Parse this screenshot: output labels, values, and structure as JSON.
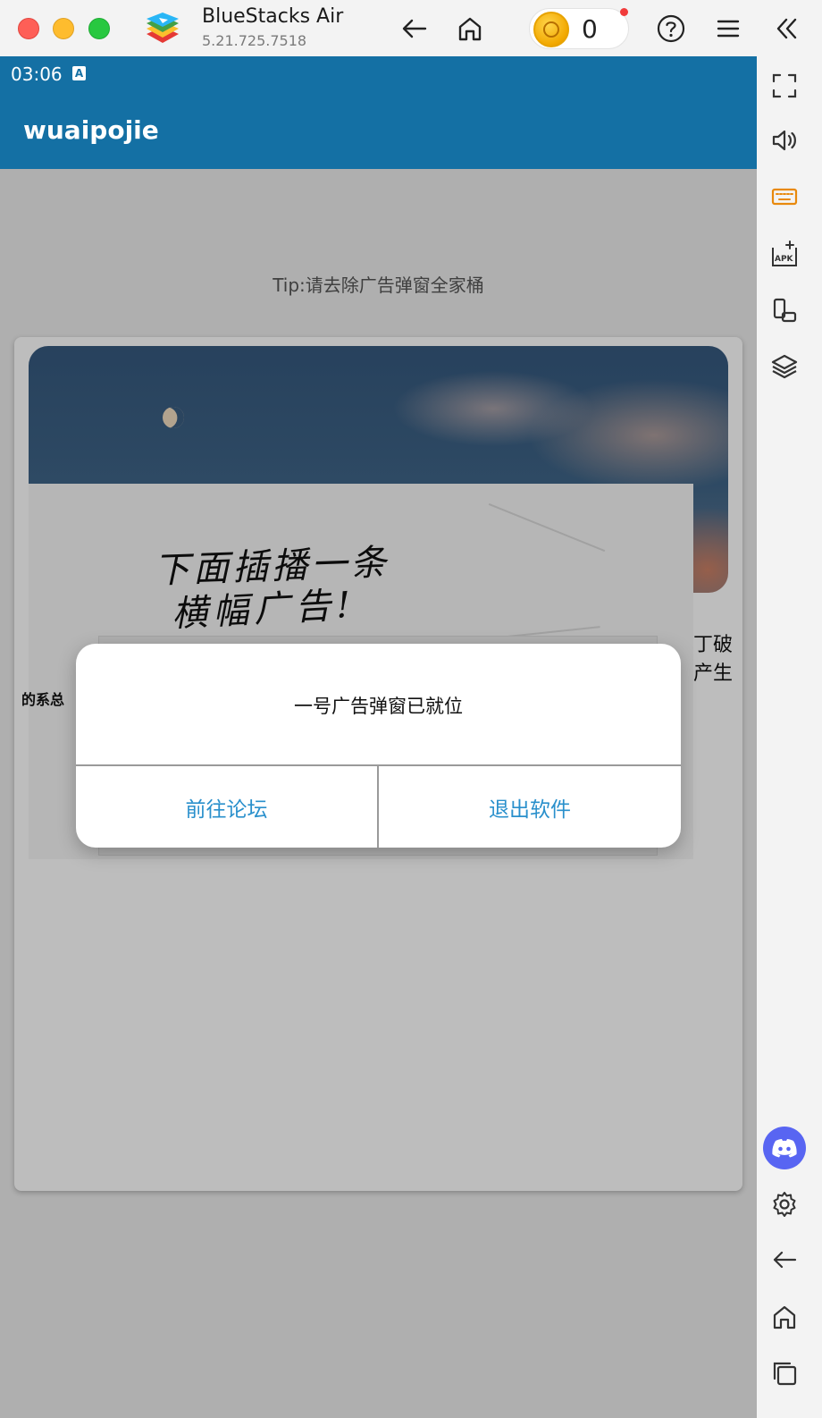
{
  "window": {
    "app_name": "BlueStacks Air",
    "version": "5.21.725.7518",
    "coin_count": "0"
  },
  "toolbar_icons": [
    "back-arrow-icon",
    "home-icon",
    "help-icon",
    "menu-icon",
    "collapse-icon"
  ],
  "sidebar_icons": [
    "fullscreen-icon",
    "volume-icon",
    "keyboard-icon",
    "apk-install-icon",
    "screen-rotate-icon",
    "layers-icon",
    "discord-icon",
    "settings-icon",
    "back-icon",
    "home-icon",
    "recent-apps-icon"
  ],
  "android": {
    "status_time": "03:06",
    "app_title": "wuaipojie",
    "tip": "Tip:请去除广告弹窗全家桶"
  },
  "banner": {
    "line1": "下面插播一条",
    "line2": "横幅广告!"
  },
  "fragments": {
    "right_1": "丁破",
    "right_2": "产生",
    "left": "的系总"
  },
  "dialog": {
    "message": "一号广告弹窗已就位",
    "left_button": "前往论坛",
    "right_button": "退出软件"
  },
  "colors": {
    "android_primary": "#1470a4",
    "dialog_button_text": "#2a90cc",
    "discord_brand": "#5865f2",
    "coin_gold": "#f2a800",
    "keyboard_accent": "#e8890c"
  }
}
